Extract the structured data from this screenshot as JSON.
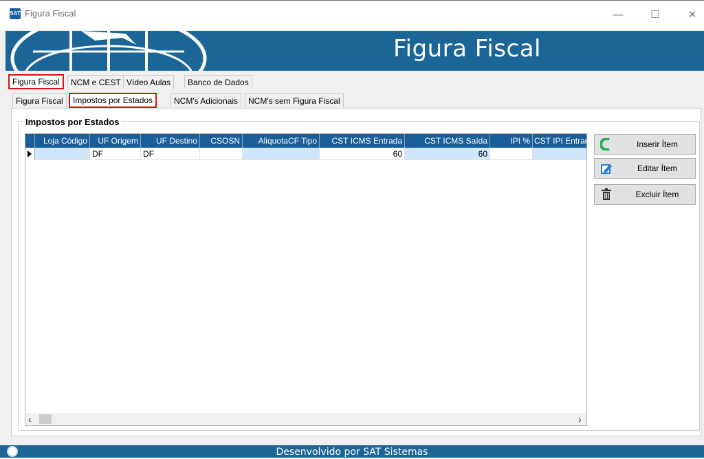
{
  "window": {
    "title": "Figura Fiscal",
    "app_icon_text": "SAT",
    "controls": {
      "minimize": "—",
      "maximize": "☐",
      "close": "✕"
    }
  },
  "banner": {
    "title": "Figura Fiscal"
  },
  "main_tabs": [
    {
      "label": "Figura Fiscal",
      "active": true
    },
    {
      "label": "NCM e CEST",
      "active": false
    },
    {
      "label": "Vídeo Aulas",
      "active": false
    },
    {
      "label": "Banco de Dados",
      "active": false
    }
  ],
  "sub_tabs": [
    {
      "label": "Figura Fiscal",
      "active": false
    },
    {
      "label": "Impostos por Estados",
      "active": true
    },
    {
      "label": "NCM's Adicionais",
      "active": false
    },
    {
      "label": "NCM's sem Figura Fiscal",
      "active": false
    }
  ],
  "group": {
    "title": "Impostos por Estados"
  },
  "grid": {
    "columns": [
      "Loja Código",
      "UF Origem",
      "UF Destino",
      "CSOSN",
      "AliquotaCF Tipo",
      "CST ICMS Entrada",
      "CST ICMS Saída",
      "IPI %",
      "CST IPI Entrad"
    ],
    "rows": [
      [
        "",
        "DF",
        "DF",
        "",
        "",
        "60",
        "60",
        "",
        ""
      ]
    ]
  },
  "actions": {
    "insert": "Inserir Ítem",
    "edit": "Editar Ítem",
    "delete": "Excluir Ítem"
  },
  "footer": {
    "text": "Desenvolvido por SAT Sistemas"
  },
  "colors": {
    "brand_blue": "#1c6597",
    "header_blue": "#1a5e9a",
    "highlight": "#cfe7fa",
    "active_tab_border": "#e01010"
  }
}
